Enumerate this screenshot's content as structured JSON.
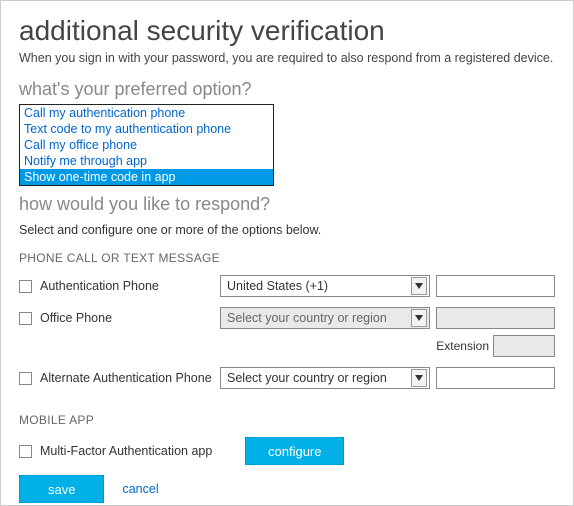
{
  "header": {
    "title": "additional security verification",
    "subtitle": "When you sign in with your password, you are required to also respond from a registered device."
  },
  "preferred": {
    "question": "what's your preferred option?",
    "options": [
      "Call my authentication phone",
      "Text code to my authentication phone",
      "Call my office phone",
      "Notify me through app",
      "Show one-time code in app"
    ],
    "selected_index": 4
  },
  "respond": {
    "question": "how would you like to respond?",
    "hint": "Select and configure one or more of the options below."
  },
  "phone_group": {
    "title": "PHONE CALL OR TEXT MESSAGE",
    "rows": {
      "auth": {
        "label": "Authentication Phone",
        "country": "United States (+1)",
        "enabled": true
      },
      "office": {
        "label": "Office Phone",
        "country": "Select your country or region",
        "enabled": false,
        "extension_label": "Extension"
      },
      "alt": {
        "label": "Alternate Authentication Phone",
        "country": "Select your country or region",
        "enabled": true
      }
    }
  },
  "app_group": {
    "title": "MOBILE APP",
    "row": {
      "label": "Multi-Factor Authentication app",
      "button": "configure"
    }
  },
  "actions": {
    "save": "save",
    "cancel": "cancel"
  }
}
